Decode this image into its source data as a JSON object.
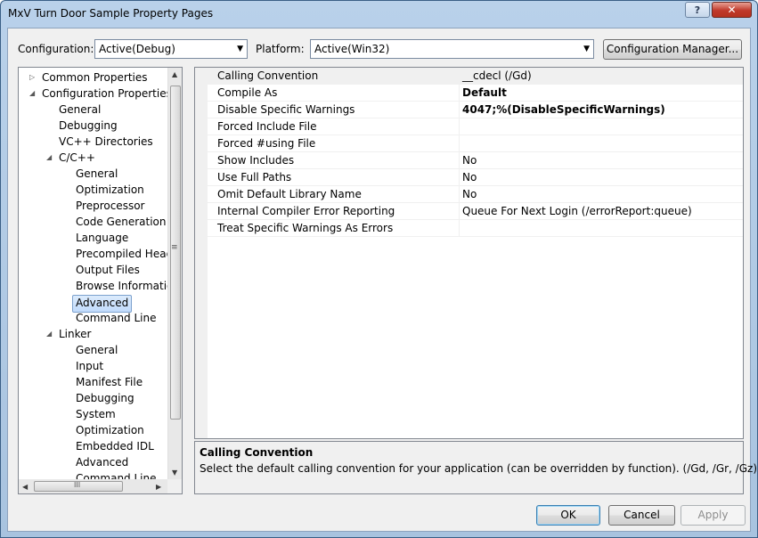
{
  "window": {
    "title": "MxV Turn Door Sample Property Pages",
    "help_label": "?",
    "close_label": "✕"
  },
  "toolbar": {
    "configuration_label": "Configuration:",
    "configuration_value": "Active(Debug)",
    "platform_label": "Platform:",
    "platform_value": "Active(Win32)",
    "config_manager_label": "Configuration Manager..."
  },
  "tree": {
    "common_properties": "Common Properties",
    "configuration_properties": "Configuration Properties",
    "general": "General",
    "debugging": "Debugging",
    "vcpp_directories": "VC++ Directories",
    "cpp": "C/C++",
    "cpp_general": "General",
    "cpp_optimization": "Optimization",
    "cpp_preprocessor": "Preprocessor",
    "cpp_code_generation": "Code Generation",
    "cpp_language": "Language",
    "cpp_precompiled_headers": "Precompiled Heade",
    "cpp_output_files": "Output Files",
    "cpp_browse_information": "Browse Information",
    "cpp_advanced": "Advanced",
    "cpp_command_line": "Command Line",
    "linker": "Linker",
    "linker_general": "General",
    "linker_input": "Input",
    "linker_manifest_file": "Manifest File",
    "linker_debugging": "Debugging",
    "linker_system": "System",
    "linker_optimization": "Optimization",
    "linker_embedded_idl": "Embedded IDL",
    "linker_advanced": "Advanced",
    "linker_command_line": "Command Line",
    "hscroll_grip": "III",
    "vscroll_grip": "≡"
  },
  "grid": {
    "rows": [
      {
        "name": "Calling Convention",
        "value": "__cdecl (/Gd)"
      },
      {
        "name": "Compile As",
        "value": "Default"
      },
      {
        "name": "Disable Specific Warnings",
        "value": "4047;%(DisableSpecificWarnings)"
      },
      {
        "name": "Forced Include File",
        "value": ""
      },
      {
        "name": "Forced #using File",
        "value": ""
      },
      {
        "name": "Show Includes",
        "value": "No"
      },
      {
        "name": "Use Full Paths",
        "value": "No"
      },
      {
        "name": "Omit Default Library Name",
        "value": "No"
      },
      {
        "name": "Internal Compiler Error Reporting",
        "value": "Queue For Next Login (/errorReport:queue)"
      },
      {
        "name": "Treat Specific Warnings As Errors",
        "value": ""
      }
    ]
  },
  "description": {
    "title": "Calling Convention",
    "text": "Select the default calling convention for your application (can be overridden by function).     (/Gd, /Gr, /Gz)"
  },
  "buttons": {
    "ok": "OK",
    "cancel": "Cancel",
    "apply": "Apply"
  }
}
